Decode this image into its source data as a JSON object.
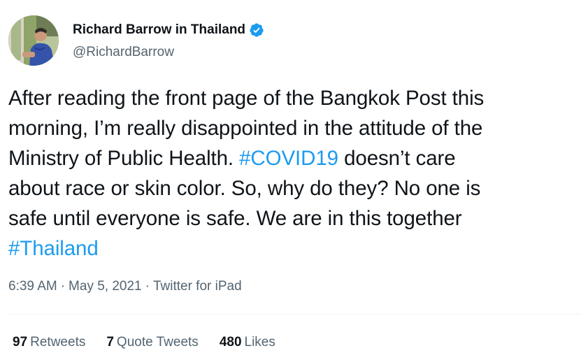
{
  "author": {
    "display_name": "Richard Barrow in Thailand",
    "handle": "@RichardBarrow",
    "verified": true,
    "avatar_icon": "profile-photo"
  },
  "tweet": {
    "lines": [
      [
        {
          "text": "After reading the front page of the Bangkok Post this"
        }
      ],
      [
        {
          "text": "morning, I’m really disappointed in the attitude of the"
        }
      ],
      [
        {
          "text": "Ministry of Public Health. "
        },
        {
          "text": "#COVID19",
          "hashtag": true
        },
        {
          "text": " doesn’t care"
        }
      ],
      [
        {
          "text": "about race or skin color. So, why do they? No one is"
        }
      ],
      [
        {
          "text": "safe until everyone is safe. We are in this together"
        }
      ],
      [
        {
          "text": "#Thailand",
          "hashtag": true
        }
      ]
    ]
  },
  "meta": {
    "time": "6:39 AM",
    "separator": "·",
    "date": "May 5, 2021",
    "source": "Twitter for iPad"
  },
  "stats": {
    "retweets_count": "97",
    "retweets_label": "Retweets",
    "quotes_count": "7",
    "quotes_label": "Quote Tweets",
    "likes_count": "480",
    "likes_label": "Likes"
  },
  "colors": {
    "text": "#0f1419",
    "secondary": "#536471",
    "link": "#1d9bf0",
    "verified": "#1d9bf0",
    "divider": "#eff3f4"
  }
}
